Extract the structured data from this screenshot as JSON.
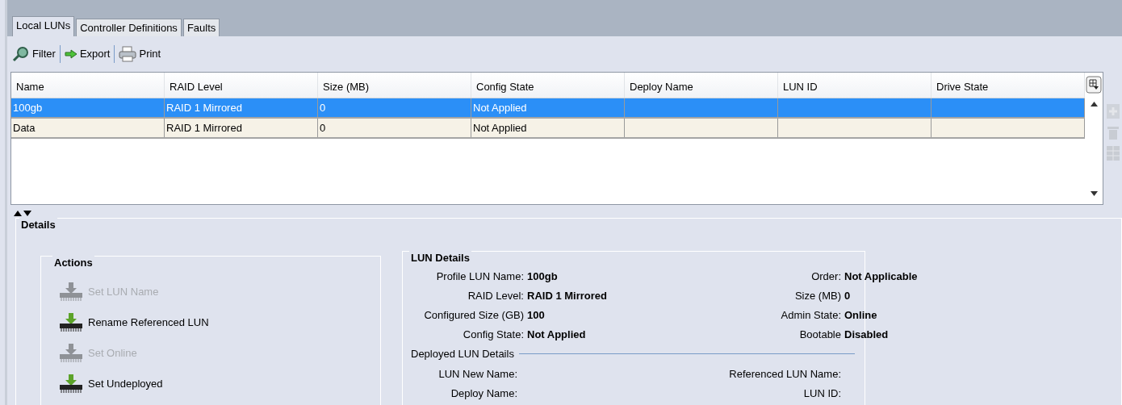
{
  "tabs": [
    {
      "label": "Local LUNs",
      "selected": true
    },
    {
      "label": "Controller Definitions",
      "selected": false
    },
    {
      "label": "Faults",
      "selected": false
    }
  ],
  "toolbar": [
    {
      "kind": "filter",
      "label": "Filter"
    },
    {
      "kind": "export",
      "label": "Export"
    },
    {
      "kind": "print",
      "label": "Print"
    }
  ],
  "table": {
    "columns": [
      "Name",
      "RAID Level",
      "Size (MB)",
      "Config State",
      "Deploy Name",
      "LUN ID",
      "Drive State"
    ],
    "rows": [
      {
        "selected": true,
        "cells": [
          "100gb",
          "RAID 1 Mirrored",
          "0",
          "Not Applied",
          "",
          "",
          ""
        ]
      },
      {
        "selected": false,
        "cells": [
          "Data",
          "RAID 1 Mirrored",
          "0",
          "Not Applied",
          "",
          "",
          ""
        ]
      }
    ]
  },
  "details": {
    "title": "Details",
    "actions": {
      "title": "Actions",
      "items": [
        {
          "label": "Set LUN Name",
          "disabled": true
        },
        {
          "label": "Rename Referenced LUN",
          "disabled": false
        },
        {
          "label": "Set Online",
          "disabled": true
        },
        {
          "label": "Set Undeployed",
          "disabled": false
        }
      ]
    },
    "lun_details": {
      "title": "LUN Details",
      "left": [
        {
          "label": "Profile LUN Name:",
          "value": "100gb"
        },
        {
          "label": "RAID Level:",
          "value": "RAID 1 Mirrored"
        },
        {
          "label": "Configured Size (GB)",
          "value": "100"
        },
        {
          "label": "Config State:",
          "value": "Not Applied"
        }
      ],
      "right": [
        {
          "label": "Order:",
          "value": "Not Applicable"
        },
        {
          "label": "Size (MB)",
          "value": "0"
        },
        {
          "label": "Admin State:",
          "value": "Online"
        },
        {
          "label": "Bootable",
          "value": "Disabled"
        }
      ],
      "deployed": {
        "title": "Deployed LUN Details",
        "left": [
          {
            "label": "LUN New Name:"
          },
          {
            "label": "Deploy Name:"
          }
        ],
        "right": [
          {
            "label": "Referenced LUN Name:"
          },
          {
            "label": "LUN ID:"
          }
        ]
      }
    }
  }
}
